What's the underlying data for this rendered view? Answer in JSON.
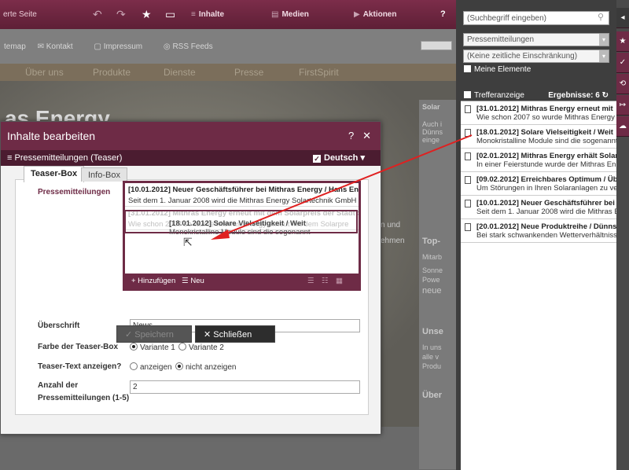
{
  "topbar": {
    "seite_label": "erte Seite",
    "inhalte": "Inhalte",
    "medien": "Medien",
    "aktionen": "Aktionen",
    "help": "?"
  },
  "site": {
    "toplinks": [
      "temap",
      "Kontakt",
      "Impressum",
      "RSS Feeds"
    ],
    "nav": [
      "Über uns",
      "Produkte",
      "Dienste",
      "Presse",
      "FirstSpirit"
    ],
    "hero_title": "as Energy",
    "right_header": "Solar",
    "right_lines": [
      "Auch i",
      "Dünns",
      "einge"
    ],
    "side_texts": [
      "n und",
      "ehmen"
    ],
    "col_headers": [
      "Top-",
      "Unse",
      "Über"
    ],
    "col_lines": [
      "Mitarb",
      "Sonne",
      "Powe",
      "neue",
      "In uns",
      "alle v",
      "Produ"
    ]
  },
  "dialog": {
    "title": "Inhalte bearbeiten",
    "help": "?",
    "close": "✕",
    "subtitle": "Pressemitteilungen (Teaser)",
    "language": "Deutsch",
    "tabs": [
      "Teaser-Box",
      "Info-Box"
    ],
    "labels": {
      "pressemitteilungen": "Pressemitteilungen",
      "ueberschrift": "Überschrift",
      "farbe": "Farbe der Teaser-Box",
      "teaser_text": "Teaser-Text anzeigen?",
      "anzahl_1": "Anzahl der",
      "anzahl_2": "Pressemitteilungen (1-5)"
    },
    "list_items": [
      {
        "title": "[10.01.2012] Neuer Geschäftsführer bei Mithras Energy / Hans Ener",
        "summary": "Seit dem 1. Januar 2008 wird die Mithras Energy Solartechnik GmbH in"
      },
      {
        "title": "[31.01.2012] Mithras Energy erneut mit dem Solarpreis der Stadt S",
        "summary": "Wie schon 2007 so wurde Mithras Energy erneut mit dem Solarpre"
      }
    ],
    "drag_item": {
      "title": "[18.01.2012] Solare Vielseitigkeit / Weit",
      "summary": "Monokristalline Module sind die sogenannt"
    },
    "list_add": "+ Hinzufügen",
    "list_new": "Neu",
    "ueberschrift_value": "News",
    "farbe_options": [
      "Variante 1",
      "Variante 2"
    ],
    "teaser_options": [
      "anzeigen",
      "nicht anzeigen"
    ],
    "anzahl_value": "2",
    "save": "Speichern",
    "close_btn": "Schließen"
  },
  "search": {
    "placeholder": "(Suchbegriff eingeben)",
    "category": "Pressemitteilungen",
    "time": "(Keine zeitliche Einschränkung)",
    "my_elements": "Meine Elemente",
    "treffer": "Trefferanzeige",
    "count_label": "Ergebnisse: 6",
    "results": [
      {
        "title": "[31.01.2012] Mithras Energy erneut mit",
        "summary": "Wie schon 2007 so wurde Mithras Energy"
      },
      {
        "title": "[18.01.2012] Solare Vielseitigkeit / Weit",
        "summary": "Monokristalline Module sind die sogenannt"
      },
      {
        "title": "[02.01.2012] Mithras Energy erhält Solar",
        "summary": "In einer Feierstunde wurde der Mithras En"
      },
      {
        "title": "[09.02.2012] Erreichbares Optimum / Üb",
        "summary": "Um Störungen in Ihren Solaranlagen zu ve"
      },
      {
        "title": "[10.01.2012] Neuer Geschäftsführer bei",
        "summary": "Seit dem 1. Januar 2008 wird die Mithras E"
      },
      {
        "title": "[20.01.2012] Neue Produktreihe / Dünns",
        "summary": "Bei stark schwankenden Wetterverhältniss"
      }
    ]
  },
  "colors": {
    "accent": "#6e2b46",
    "arrow": "#e02020"
  }
}
